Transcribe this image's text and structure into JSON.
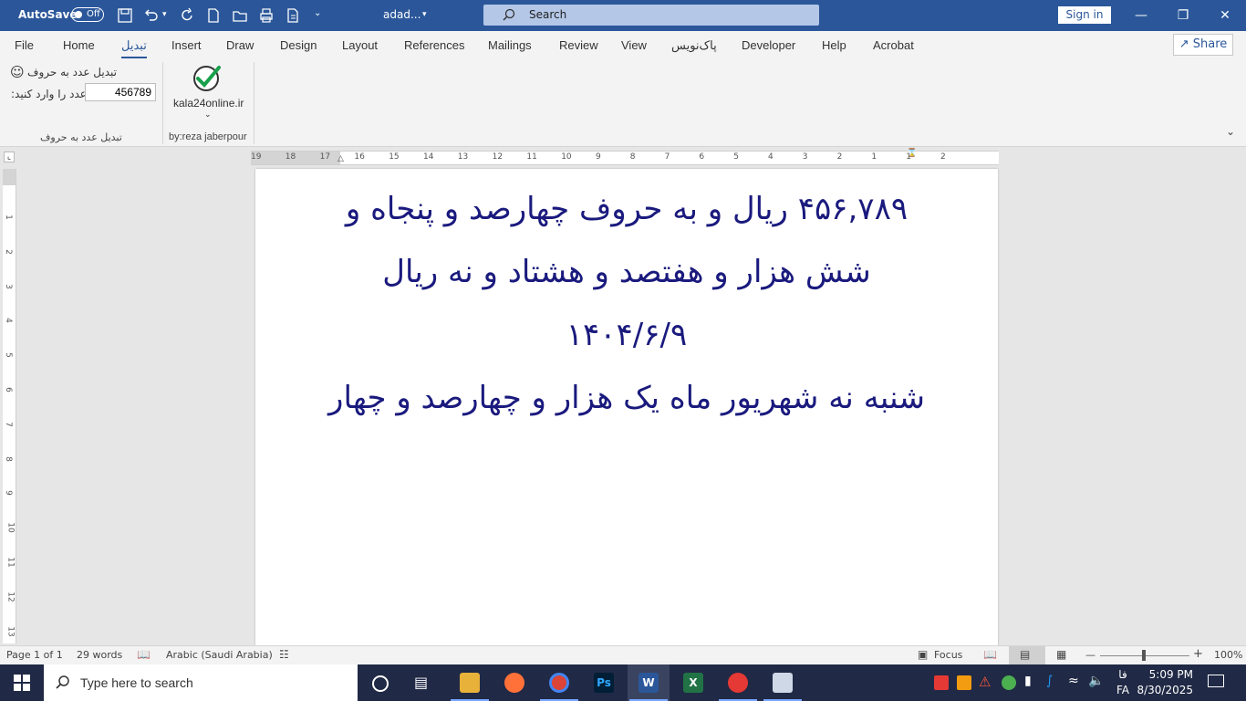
{
  "titlebar": {
    "autosave_label": "AutoSave",
    "autosave_state": "Off",
    "doc_title": "adad...",
    "search_placeholder": "Search",
    "signin_label": "Sign in"
  },
  "tabs": [
    "File",
    "Home",
    "تبدیل",
    "Insert",
    "Draw",
    "Design",
    "Layout",
    "References",
    "Mailings",
    "Review",
    "View",
    "پاک‌نویس",
    "Developer",
    "Help",
    "Acrobat"
  ],
  "active_tab": "تبدیل",
  "share_label": "Share",
  "ribbon": {
    "convert_label": "تبدیل عدد به حروف",
    "enter_number_label": "عدد را وارد کنید:",
    "number_value": "456789",
    "group1_label": "تبدیل عدد به حروف",
    "site_label": "kala24online.ir",
    "group2_label": "by:reza jaberpour"
  },
  "document": {
    "lines": [
      "۴۵۶,۷۸۹ ریال  و به حروف چهارصد و پنجاه و",
      "شش هزار و هفتصد و هشتاد و نه ریال",
      "۱۴۰۴/۶/۹",
      "شنبه نه شهریور ماه یک هزار و چهارصد و چهار"
    ],
    "text_color": "#1a1a7e"
  },
  "ruler": {
    "h_numbers": [
      "19",
      "18",
      "17",
      "16",
      "15",
      "14",
      "13",
      "12",
      "11",
      "10",
      "9",
      "8",
      "7",
      "6",
      "5",
      "4",
      "3",
      "2",
      "1",
      "1",
      "2"
    ],
    "v_numbers": [
      "1",
      "2",
      "3",
      "4",
      "5",
      "6",
      "7",
      "8",
      "9",
      "10",
      "11",
      "12",
      "13"
    ]
  },
  "status": {
    "page": "Page 1 of 1",
    "words": "29 words",
    "language": "Arabic (Saudi Arabia)",
    "focus": "Focus",
    "zoom": "100%"
  },
  "taskbar": {
    "search_placeholder": "Type here to search",
    "lang_top": "فا",
    "lang_bottom": "FA",
    "time": "5:09 PM",
    "date": "8/30/2025"
  },
  "colors": {
    "accent": "#2b579a",
    "taskbar": "#202945"
  }
}
